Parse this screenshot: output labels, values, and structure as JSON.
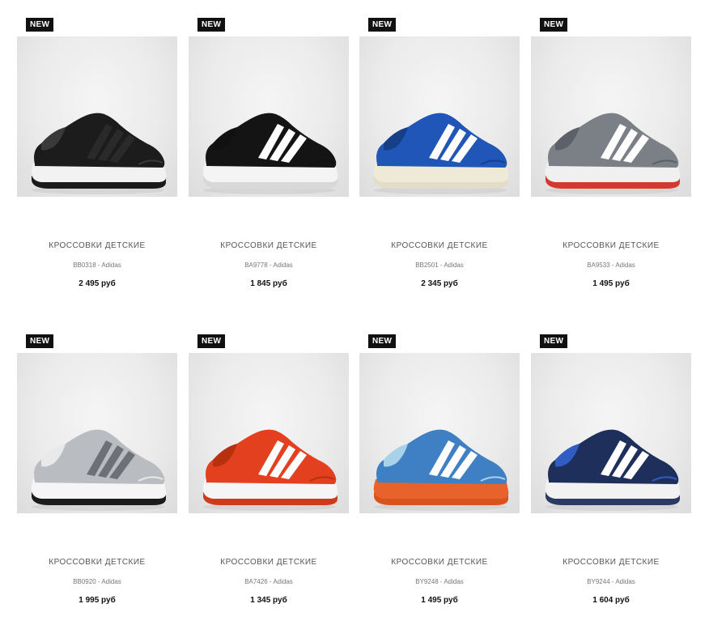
{
  "products": [
    {
      "badge": "NEW",
      "title": "КРОССОВКИ ДЕТСКИЕ",
      "sku": "BB0318",
      "brand": "Adidas",
      "price": "2 495 руб",
      "shoe_icon": "black-sneaker-icon",
      "colors": {
        "upper": "#1c1c1c",
        "stripes": "#2a2a2a",
        "sole": "#f2f2f2",
        "outsole": "#1a1a1a",
        "accent": "#3a3a3a"
      }
    },
    {
      "badge": "NEW",
      "title": "КРОССОВКИ ДЕТСКИЕ",
      "sku": "BA9778",
      "brand": "Adidas",
      "price": "1 845 руб",
      "shoe_icon": "black-slip-on-sneaker-icon",
      "colors": {
        "upper": "#141414",
        "stripes": "#ffffff",
        "sole": "#f4f4f4",
        "outsole": "#d8d8d8",
        "accent": "#111111"
      }
    },
    {
      "badge": "NEW",
      "title": "КРОССОВКИ ДЕТСКИЕ",
      "sku": "BB2501",
      "brand": "Adidas",
      "price": "2 345 руб",
      "shoe_icon": "blue-sneaker-icon",
      "colors": {
        "upper": "#1f56b8",
        "stripes": "#ffffff",
        "sole": "#efe9d8",
        "outsole": "#e2dcc8",
        "accent": "#163f8a"
      }
    },
    {
      "badge": "NEW",
      "title": "КРОССОВКИ ДЕТСКИЕ",
      "sku": "BA9533",
      "brand": "Adidas",
      "price": "1 495 руб",
      "shoe_icon": "grey-velcro-sneaker-icon",
      "colors": {
        "upper": "#7b7f86",
        "stripes": "#ffffff",
        "sole": "#f0f0f0",
        "outsole": "#d33a2c",
        "accent": "#5c6068"
      }
    },
    {
      "badge": "NEW",
      "title": "КРОССОВКИ ДЕТСКИЕ",
      "sku": "BB0920",
      "brand": "Adidas",
      "price": "1 995 руб",
      "shoe_icon": "grey-print-sneaker-icon",
      "colors": {
        "upper": "#b9bcc0",
        "stripes": "#6d7177",
        "sole": "#f5f5f5",
        "outsole": "#1b1b1b",
        "accent": "#e9e9e9"
      }
    },
    {
      "badge": "NEW",
      "title": "КРОССОВКИ ДЕТСКИЕ",
      "sku": "BA7426",
      "brand": "Adidas",
      "price": "1 345 руб",
      "shoe_icon": "red-velcro-sneaker-icon",
      "colors": {
        "upper": "#e2401f",
        "stripes": "#ffffff",
        "sole": "#f5f5f5",
        "outsole": "#cf3a1b",
        "accent": "#b8310f"
      }
    },
    {
      "badge": "NEW",
      "title": "КРОССОВКИ ДЕТСКИЕ",
      "sku": "BY9248",
      "brand": "Adidas",
      "price": "1 495 руб",
      "shoe_icon": "blue-orange-sneaker-icon",
      "colors": {
        "upper": "#3f7fc3",
        "stripes": "#ffffff",
        "sole": "#e8632c",
        "outsole": "#d9531f",
        "accent": "#a7d2ea"
      }
    },
    {
      "badge": "NEW",
      "title": "КРОССОВКИ ДЕТСКИЕ",
      "sku": "BY9244",
      "brand": "Adidas",
      "price": "1 604 руб",
      "shoe_icon": "navy-velcro-sneaker-icon",
      "colors": {
        "upper": "#1f2f5c",
        "stripes": "#ffffff",
        "sole": "#f2f2f2",
        "outsole": "#2a3a62",
        "accent": "#2f5dc4"
      }
    }
  ]
}
